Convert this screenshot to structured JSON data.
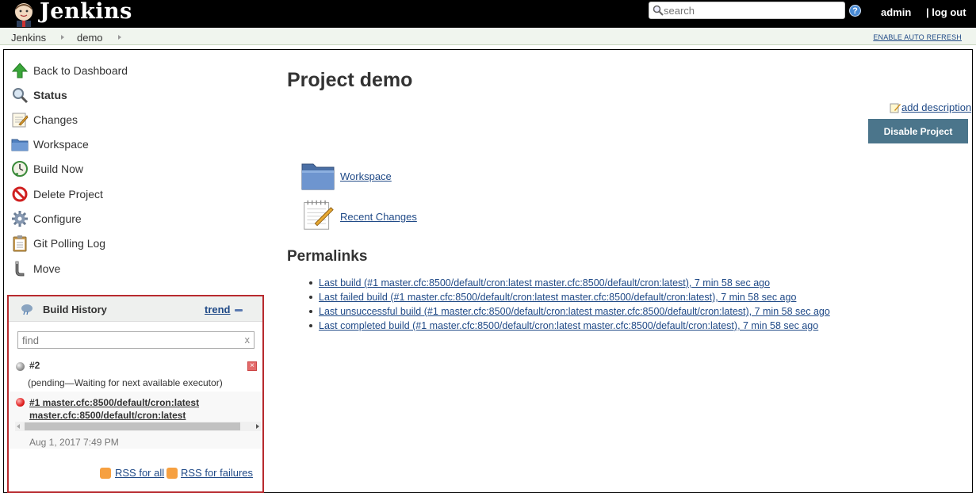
{
  "header": {
    "logo_text": "Jenkins",
    "search_placeholder": "search",
    "help_label": "?",
    "user": "admin",
    "logout": "| log out"
  },
  "breadcrumb": {
    "items": [
      "Jenkins",
      "demo"
    ],
    "auto_refresh": "ENABLE AUTO REFRESH"
  },
  "sidebar": {
    "tasks": [
      {
        "label": "Back to Dashboard",
        "icon": "up-arrow-icon"
      },
      {
        "label": "Status",
        "icon": "magnifier-icon",
        "active": true
      },
      {
        "label": "Changes",
        "icon": "notepad-icon"
      },
      {
        "label": "Workspace",
        "icon": "folder-icon"
      },
      {
        "label": "Build Now",
        "icon": "clock-icon"
      },
      {
        "label": "Delete Project",
        "icon": "no-entry-icon"
      },
      {
        "label": "Configure",
        "icon": "gear-icon"
      },
      {
        "label": "Git Polling Log",
        "icon": "clipboard-icon"
      },
      {
        "label": "Move",
        "icon": "pipe-icon"
      }
    ]
  },
  "build_history": {
    "title": "Build History",
    "trend": "trend",
    "find_placeholder": "find",
    "find_clear": "x",
    "builds": [
      {
        "number": "#2",
        "status": "(pending—Waiting for next available executor)",
        "ball": "grey"
      },
      {
        "name_line1": "#1 master.cfc:8500/default/cron:latest",
        "name_line2": "master.cfc:8500/default/cron:latest",
        "date": "Aug 1, 2017 7:49 PM",
        "ball": "red"
      }
    ],
    "rss_all": "RSS for all",
    "rss_failures": "RSS for failures"
  },
  "main": {
    "title": "Project demo",
    "add_description": "add description",
    "disable_button": "Disable Project",
    "links": [
      {
        "label": "Workspace",
        "icon": "folder-icon"
      },
      {
        "label": "Recent Changes",
        "icon": "notepad-icon"
      }
    ],
    "permalinks_title": "Permalinks",
    "permalinks": [
      "Last build (#1 master.cfc:8500/default/cron:latest master.cfc:8500/default/cron:latest), 7 min 58 sec ago",
      "Last failed build (#1 master.cfc:8500/default/cron:latest master.cfc:8500/default/cron:latest), 7 min 58 sec ago",
      "Last unsuccessful build (#1 master.cfc:8500/default/cron:latest master.cfc:8500/default/cron:latest), 7 min 58 sec ago",
      "Last completed build (#1 master.cfc:8500/default/cron:latest master.cfc:8500/default/cron:latest), 7 min 58 sec ago"
    ]
  },
  "colors": {
    "header_bg": "#000000",
    "breadcrumb_bg": "#f0f5ee",
    "link": "#204A87",
    "button_bg": "#4b758b",
    "highlight_border": "#b82a2e"
  }
}
